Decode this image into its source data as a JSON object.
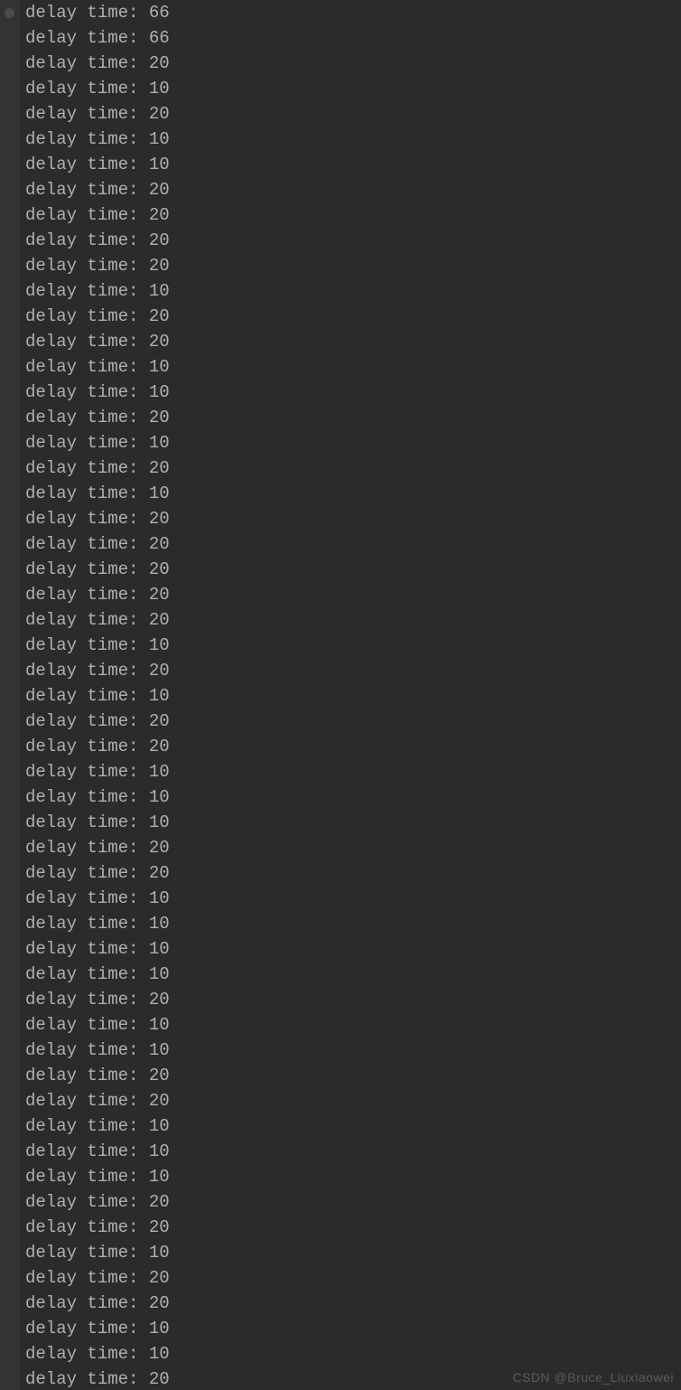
{
  "console": {
    "label_prefix": "delay time: ",
    "lines": [
      "66",
      "66",
      "20",
      "10",
      "20",
      "10",
      "10",
      "20",
      "20",
      "20",
      "20",
      "10",
      "20",
      "20",
      "10",
      "10",
      "20",
      "10",
      "20",
      "10",
      "20",
      "20",
      "20",
      "20",
      "20",
      "10",
      "20",
      "10",
      "20",
      "20",
      "10",
      "10",
      "10",
      "20",
      "20",
      "10",
      "10",
      "10",
      "10",
      "20",
      "10",
      "10",
      "20",
      "20",
      "10",
      "10",
      "10",
      "20",
      "20",
      "10",
      "20",
      "20",
      "10",
      "10",
      "20"
    ]
  },
  "watermark": {
    "text": "CSDN @Bruce_Liuxiaowei"
  }
}
